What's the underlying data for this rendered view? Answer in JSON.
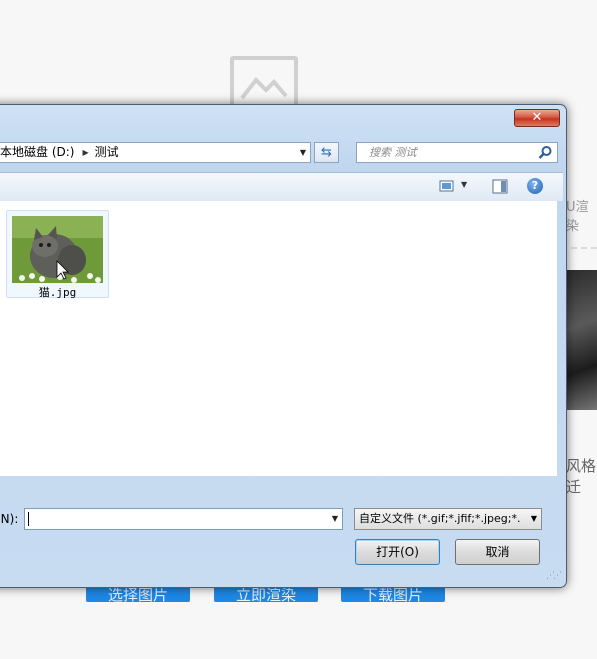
{
  "background_page": {
    "side_text_top": "U渲染",
    "side_text_mid": "风格迁",
    "buttons": [
      "选择图片",
      "立即渲染",
      "下载图片"
    ]
  },
  "dialog": {
    "close_label": "✕",
    "address": {
      "drive": "本地磁盘 (D:)",
      "folder": "测试"
    },
    "search": {
      "placeholder": "搜索 测试"
    },
    "files": [
      {
        "name": "猫.jpg"
      }
    ],
    "filename": {
      "label": "(N):",
      "value": ""
    },
    "filter": {
      "selected": "自定义文件 (*.gif;*.jfif;*.jpeg;*."
    },
    "buttons": {
      "open": "打开(O)",
      "cancel": "取消"
    }
  }
}
